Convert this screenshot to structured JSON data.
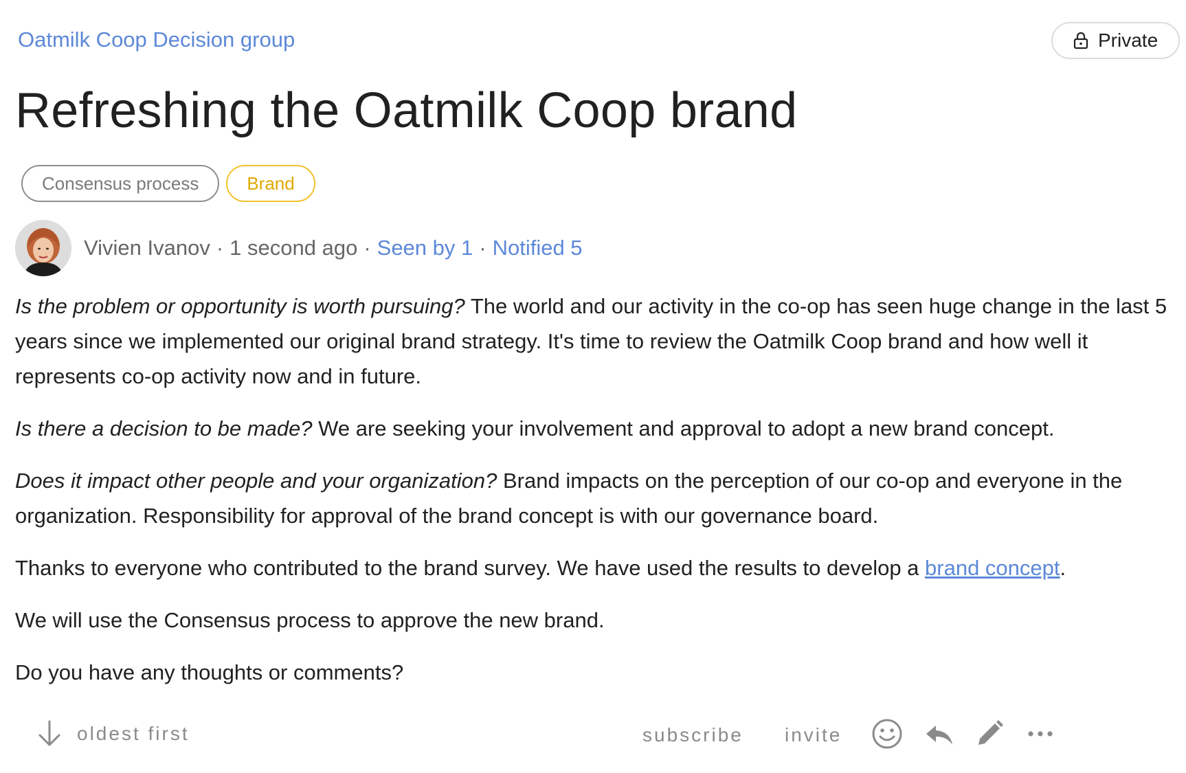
{
  "header": {
    "group_link": "Oatmilk Coop Decision group",
    "privacy_label": "Private",
    "privacy_icon": "lock-icon"
  },
  "thread": {
    "title": "Refreshing the Oatmilk Coop brand",
    "tags": [
      {
        "label": "Consensus process",
        "color": "#8e8e8e"
      },
      {
        "label": "Brand",
        "color": "#f2c12e"
      }
    ],
    "author": "Vivien Ivanov",
    "time_ago": "1 second ago",
    "seen_by": "Seen by 1",
    "notified": "Notified 5",
    "separator": "·"
  },
  "body": {
    "p1_em": "Is the problem or opportunity is worth pursuing?",
    "p1_text": " The world and our activity in the co-op has seen huge change in the last 5 years since we implemented our original brand strategy. It's time to review the Oatmilk Coop brand and how well it represents co-op activity now and in future.",
    "p2_em": "Is there a decision to be made?",
    "p2_text": " We are seeking your involvement and approval to adopt a new brand concept.",
    "p3_em": "Does it impact other people and your organization?",
    "p3_text": " Brand impacts on the perception of our co-op and everyone in the organization. Responsibility for approval of the brand concept is with our governance board.",
    "p4_text": "Thanks to everyone who contributed to the brand survey. We have used the results to develop a ",
    "p4_link": "brand concept",
    "p4_end": ".",
    "p5_text": "We will use the Consensus process to approve the new brand.",
    "p6_text": "Do you have any thoughts or comments?"
  },
  "actions": {
    "sort_label": "oldest first",
    "sort_icon": "arrow-down-icon",
    "subscribe_label": "subscribe",
    "invite_label": "invite",
    "icons": [
      "emoji-icon",
      "reply-icon",
      "edit-icon",
      "more-icon"
    ]
  },
  "colors": {
    "link": "#5c88d8",
    "text": "#212121",
    "muted": "#8a8a8a",
    "tag_brand": "#f2c12e"
  }
}
